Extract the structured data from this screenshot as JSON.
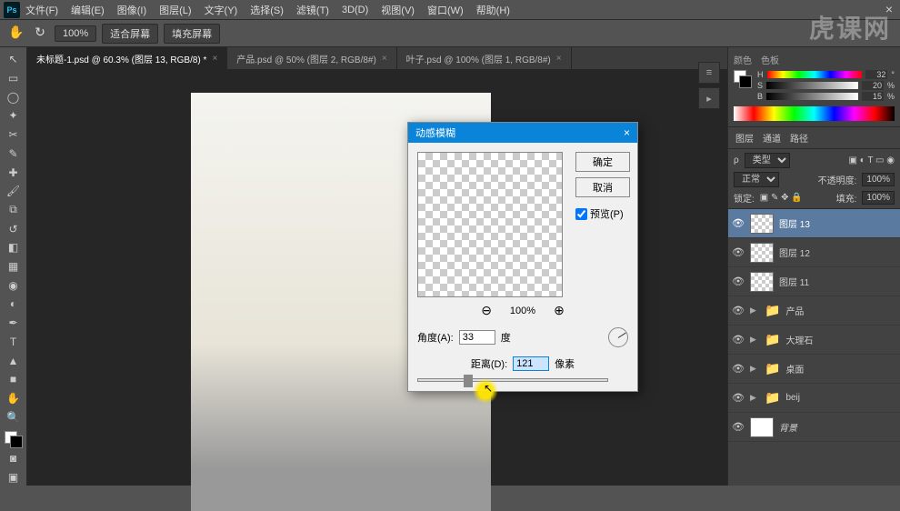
{
  "menu": {
    "file": "文件(F)",
    "edit": "编辑(E)",
    "image": "图像(I)",
    "layer": "图层(L)",
    "text": "文字(Y)",
    "select": "选择(S)",
    "filter": "滤镜(T)",
    "3d": "3D(D)",
    "view": "视图(V)",
    "window": "窗口(W)",
    "help": "帮助(H)"
  },
  "optbar": {
    "zoom": "100%",
    "fit": "适合屏幕",
    "fill": "填充屏幕"
  },
  "tabs": [
    {
      "label": "未标题-1.psd @ 60.3% (图层 13, RGB/8) *",
      "active": true
    },
    {
      "label": "产品.psd @ 50% (图层 2, RGB/8#)",
      "active": false
    },
    {
      "label": "叶子.psd @ 100% (图层 1, RGB/8#)",
      "active": false
    }
  ],
  "dialog": {
    "title": "动感模糊",
    "ok": "确定",
    "cancel": "取消",
    "preview": "预览(P)",
    "zoom": "100%",
    "angle_label": "角度(A):",
    "angle_val": "33",
    "angle_unit": "度",
    "dist_label": "距离(D):",
    "dist_val": "121",
    "dist_unit": "像素"
  },
  "color": {
    "tab1": "颜色",
    "tab2": "色板",
    "h": "H",
    "s": "S",
    "b": "B",
    "hv": "32",
    "sv": "20",
    "bv": "15",
    "hp": "%",
    "sp": "%"
  },
  "layers_panel": {
    "tab1": "图层",
    "tab2": "通道",
    "tab3": "路径",
    "kind": "类型",
    "blend": "正常",
    "opacity_label": "不透明度:",
    "opacity": "100%",
    "lock": "锁定:",
    "fill_label": "填充:",
    "fill": "100%",
    "layers": [
      {
        "name": "图层 13",
        "selected": true,
        "trans": true,
        "group": false
      },
      {
        "name": "图层 12",
        "selected": false,
        "trans": true,
        "group": false
      },
      {
        "name": "图层 11",
        "selected": false,
        "trans": true,
        "group": false
      },
      {
        "name": "产品",
        "selected": false,
        "group": true
      },
      {
        "name": "大理石",
        "selected": false,
        "group": true
      },
      {
        "name": "桌面",
        "selected": false,
        "group": true
      },
      {
        "name": "beij",
        "selected": false,
        "group": true
      },
      {
        "name": "背景",
        "selected": false,
        "italic": true,
        "white": true
      }
    ]
  },
  "watermark": "虎课网"
}
